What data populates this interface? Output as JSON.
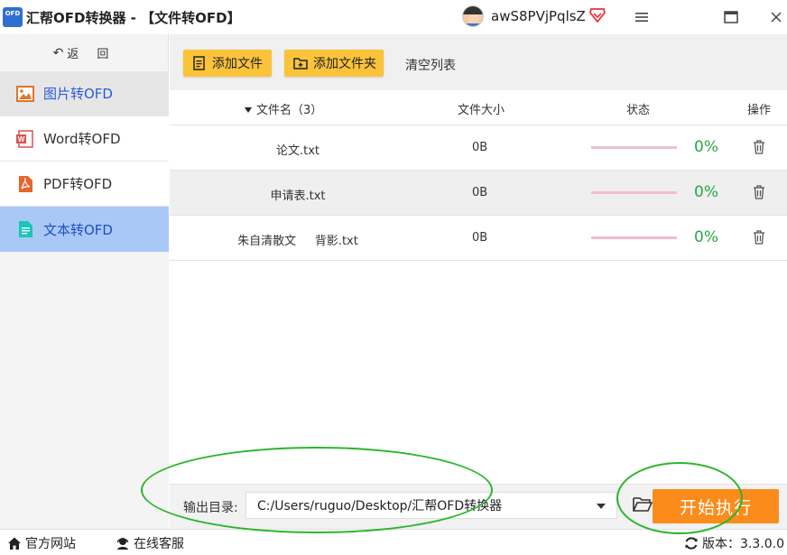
{
  "window": {
    "title": "汇帮OFD转换器 - 【文件转OFD】",
    "logo_text": "OFD",
    "username": "awS8PVjPqlsZ"
  },
  "sidebar": {
    "back_label": "返 回",
    "items": [
      {
        "label": "图片转OFD",
        "icon": "image-icon"
      },
      {
        "label": "Word转OFD",
        "icon": "word-icon"
      },
      {
        "label": "PDF转OFD",
        "icon": "pdf-icon"
      },
      {
        "label": "文本转OFD",
        "icon": "text-file-icon"
      }
    ],
    "active_index": 3
  },
  "toolbar": {
    "add_file": "添加文件",
    "add_folder": "添加文件夹",
    "clear_list": "清空列表"
  },
  "table": {
    "headers": {
      "name": "文件名（3）",
      "size": "文件大小",
      "status": "状态",
      "action": "操作"
    },
    "rows": [
      {
        "name": "论文.txt",
        "size": "0B",
        "progress": "0%"
      },
      {
        "name": "申请表.txt",
        "size": "0B",
        "progress": "0%"
      },
      {
        "name": "朱自清散文     背影.txt",
        "size": "0B",
        "progress": "0%"
      }
    ]
  },
  "output": {
    "label": "输出目录:",
    "path": "C:/Users/ruguo/Desktop/汇帮OFD转换器",
    "start_button": "开始执行"
  },
  "statusbar": {
    "website": "官方网站",
    "service": "在线客服",
    "version": "版本：3.3.0.0"
  },
  "colors": {
    "accent_yellow": "#fbc33a",
    "start_orange": "#fb8c1c",
    "active_nav": "#a9c8f6",
    "progress_green": "#27a844",
    "progress_track": "#f0bfce",
    "annotation_green": "#2bb52b"
  }
}
